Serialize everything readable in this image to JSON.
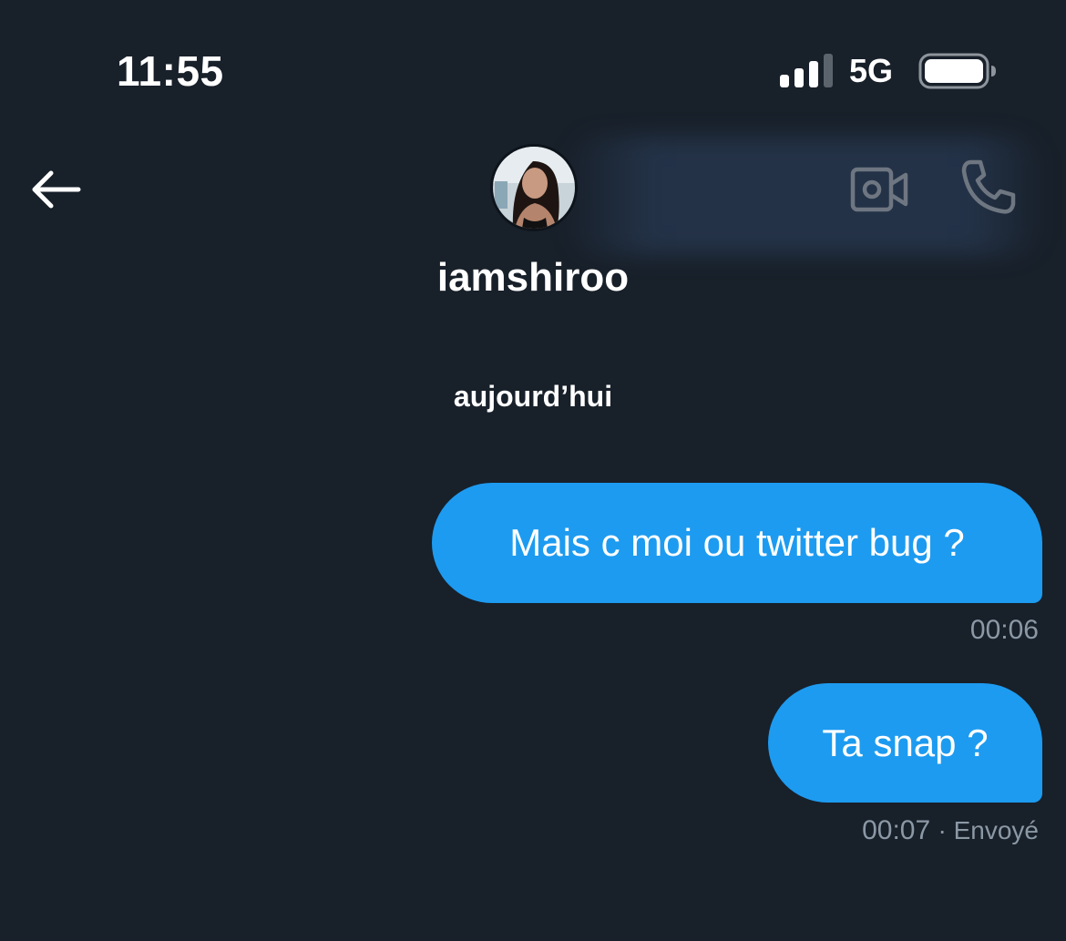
{
  "status_bar": {
    "time": "11:55",
    "network": "5G",
    "signal_icon": "cellular-signal-icon",
    "battery_icon": "battery-full-icon"
  },
  "header": {
    "back_icon": "arrow-left-icon",
    "contact_name": "iamshiroo",
    "avatar": "profile-photo",
    "video_icon": "video-camera-icon",
    "call_icon": "phone-icon"
  },
  "conversation": {
    "date_separator": "aujourd’hui",
    "messages": [
      {
        "text": "Mais c moi ou twitter bug ?",
        "time": "00:06",
        "status": ""
      },
      {
        "text": "Ta snap ?",
        "time": "00:07",
        "status": "· Envoyé"
      }
    ]
  },
  "colors": {
    "background": "#18202a",
    "bubble": "#1d9bf0",
    "meta_text": "#8b98a5",
    "icon_muted": "#6e7681"
  }
}
